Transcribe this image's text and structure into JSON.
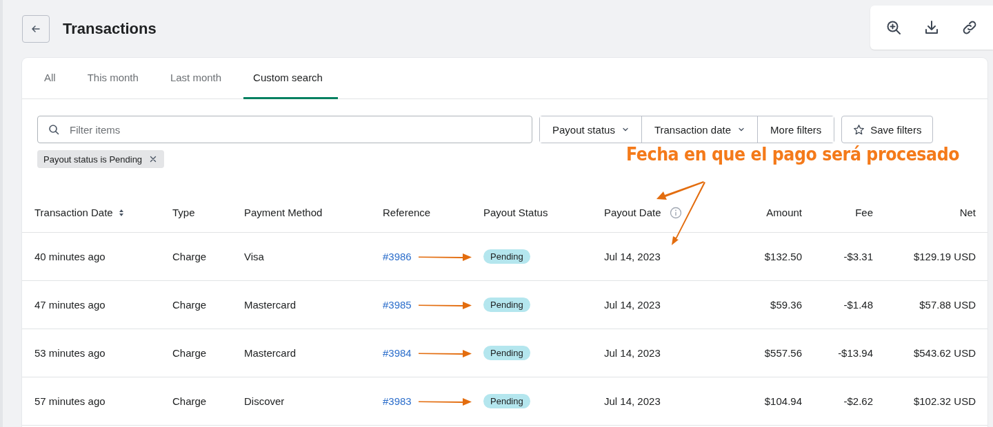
{
  "page": {
    "title": "Transactions"
  },
  "tabs": [
    {
      "label": "All",
      "selected": false
    },
    {
      "label": "This month",
      "selected": false
    },
    {
      "label": "Last month",
      "selected": false
    },
    {
      "label": "Custom search",
      "selected": true
    }
  ],
  "search": {
    "placeholder": "Filter items"
  },
  "filters": [
    {
      "label": "Payout status",
      "kind": "dropdown"
    },
    {
      "label": "Transaction date",
      "kind": "dropdown"
    },
    {
      "label": "More filters",
      "kind": "plain"
    }
  ],
  "save_button": "Save filters",
  "applied_filters": [
    {
      "label": "Payout status is Pending"
    }
  ],
  "annotation": {
    "text": "Fecha en que el pago será procesado"
  },
  "table": {
    "columns": [
      {
        "label": "Transaction Date",
        "kind": "sortable"
      },
      {
        "label": "Type",
        "kind": "plain"
      },
      {
        "label": "Payment Method",
        "kind": "plain"
      },
      {
        "label": "Reference",
        "kind": "plain"
      },
      {
        "label": "Payout Status",
        "kind": "plain"
      },
      {
        "label": "Payout Date",
        "kind": "info"
      },
      {
        "label": "Amount",
        "kind": "plain"
      },
      {
        "label": "Fee",
        "kind": "plain"
      },
      {
        "label": "Net",
        "kind": "plain"
      }
    ],
    "rows": [
      {
        "date": "40 minutes ago",
        "type": "Charge",
        "method": "Visa",
        "reference": "#3986",
        "arrow": true,
        "status": "Pending",
        "payout_date": "Jul 14, 2023",
        "amount": "$132.50",
        "fee": "-$3.31",
        "net": "$129.19 USD"
      },
      {
        "date": "47 minutes ago",
        "type": "Charge",
        "method": "Mastercard",
        "reference": "#3985",
        "arrow": true,
        "status": "Pending",
        "payout_date": "Jul 14, 2023",
        "amount": "$59.36",
        "fee": "-$1.48",
        "net": "$57.88 USD"
      },
      {
        "date": "53 minutes ago",
        "type": "Charge",
        "method": "Mastercard",
        "reference": "#3984",
        "arrow": true,
        "status": "Pending",
        "payout_date": "Jul 14, 2023",
        "amount": "$557.56",
        "fee": "-$13.94",
        "net": "$543.62 USD"
      },
      {
        "date": "57 minutes ago",
        "type": "Charge",
        "method": "Discover",
        "reference": "#3983",
        "arrow": true,
        "status": "Pending",
        "payout_date": "Jul 14, 2023",
        "amount": "$104.94",
        "fee": "-$2.62",
        "net": "$102.32 USD"
      }
    ]
  }
}
